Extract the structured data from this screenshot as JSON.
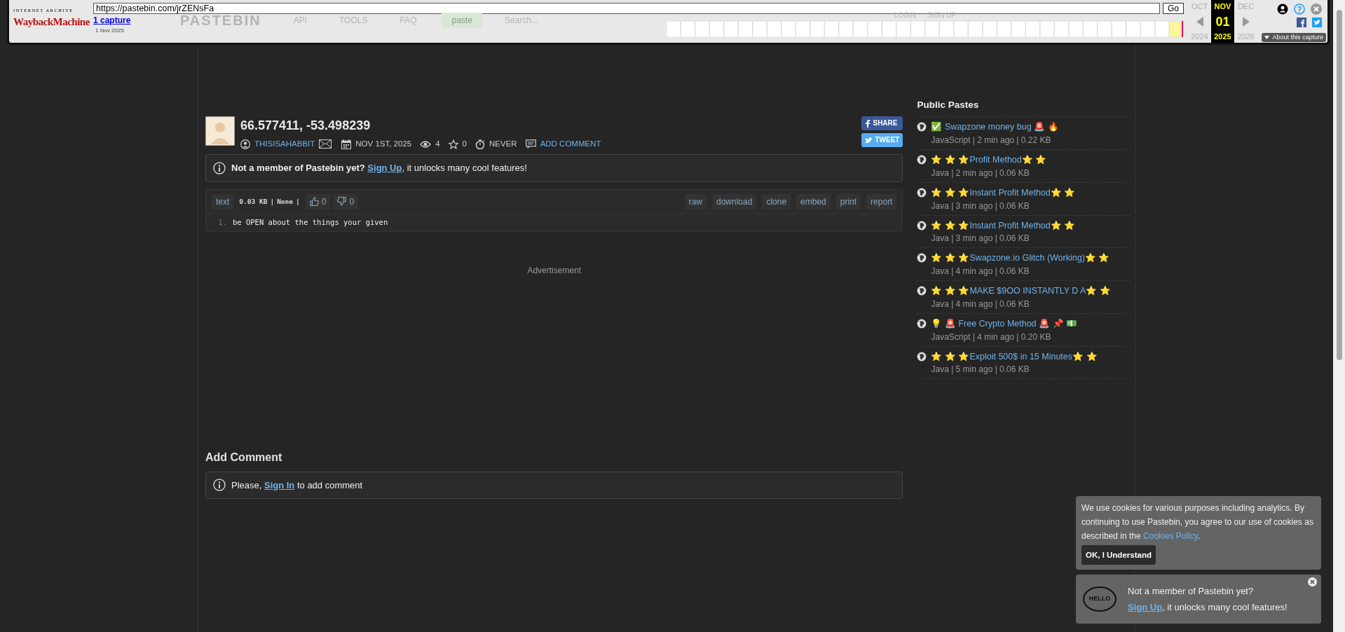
{
  "wayback": {
    "logo_top": "INTERNET ARCHIVE",
    "logo": "WaybackMachine",
    "url": "https://pastebin.com/jrZENsFa",
    "go": "Go",
    "captures": "1 capture",
    "capture_date": "1 Nov 2025",
    "months": [
      {
        "month": "OCT",
        "year": "2024",
        "selected": false
      },
      {
        "month": "NOV",
        "day": "01",
        "year": "2025",
        "selected": true
      },
      {
        "month": "DEC",
        "year": "2026",
        "selected": false
      }
    ],
    "about": "About this capture"
  },
  "site_header": {
    "logo": "PASTEBIN",
    "nav": [
      "API",
      "TOOLS",
      "FAQ"
    ],
    "paste_button": "paste",
    "search_placeholder": "Search...",
    "login": "LOGIN",
    "signup": "SIGN UP"
  },
  "paste": {
    "title": "66.577411, -53.498239",
    "author": "THISISAHABBIT",
    "date": "NOV 1ST, 2025",
    "views": "4",
    "stars": "0",
    "expires": "NEVER",
    "add_comment": "ADD COMMENT",
    "share": "SHARE",
    "tweet": "TWEET"
  },
  "notice": {
    "lead": "Not a member of Pastebin yet?",
    "link": "Sign Up",
    "tail": ", it unlocks many cool features!"
  },
  "code": {
    "syntax": "text",
    "size": "0.03 KB",
    "license": "None",
    "separators": [
      "|",
      "|"
    ],
    "likes": "0",
    "dislikes": "0",
    "actions": [
      "raw",
      "download",
      "clone",
      "embed",
      "print",
      "report"
    ],
    "lines": [
      {
        "number": "1.",
        "text": "be OPEN about the things your given"
      }
    ]
  },
  "advertisement": "Advertisement",
  "comments": {
    "heading": "Add Comment",
    "lead": "Please,",
    "link": "Sign In",
    "tail": "to add comment"
  },
  "sidebar": {
    "heading": "Public Pastes",
    "pastes": [
      {
        "title": "✅ Swapzone money bug 🚨 🔥",
        "meta": "JavaScript | 2 min ago | 0.22 KB"
      },
      {
        "title": "⭐ ⭐ ⭐Profit Method⭐ ⭐",
        "meta": "Java | 2 min ago | 0.06 KB"
      },
      {
        "title": "⭐ ⭐ ⭐Instant Profit Method⭐ ⭐",
        "meta": "Java | 3 min ago | 0.06 KB"
      },
      {
        "title": "⭐ ⭐ ⭐Instant Profit Method⭐ ⭐",
        "meta": "Java | 3 min ago | 0.06 KB"
      },
      {
        "title": "⭐ ⭐ ⭐Swapzone.io Glitch (Working)⭐ ⭐",
        "meta": "Java | 4 min ago | 0.06 KB"
      },
      {
        "title": "⭐ ⭐ ⭐MAKE $9OO INSTANTLY D A⭐ ⭐",
        "meta": "Java | 4 min ago | 0.06 KB"
      },
      {
        "title": "💡 🚨 Free Crypto Method 🚨 📌 💵",
        "meta": "JavaScript | 4 min ago | 0.20 KB"
      },
      {
        "title": "⭐ ⭐ ⭐Exploit 500$ in 15 Minutes⭐ ⭐",
        "meta": "Java | 5 min ago | 0.06 KB"
      }
    ]
  },
  "cookie": {
    "text": "We use cookies for various purposes including analytics. By continuing to use Pastebin, you agree to our use of cookies as described in the",
    "link": "Cookies Policy",
    "after": ".",
    "button": "OK, I Understand"
  },
  "signup_popup": {
    "bubble": "HELLO",
    "title": "Not a member of Pastebin yet?",
    "link": "Sign Up",
    "tail": ", it unlocks many cool features!"
  }
}
